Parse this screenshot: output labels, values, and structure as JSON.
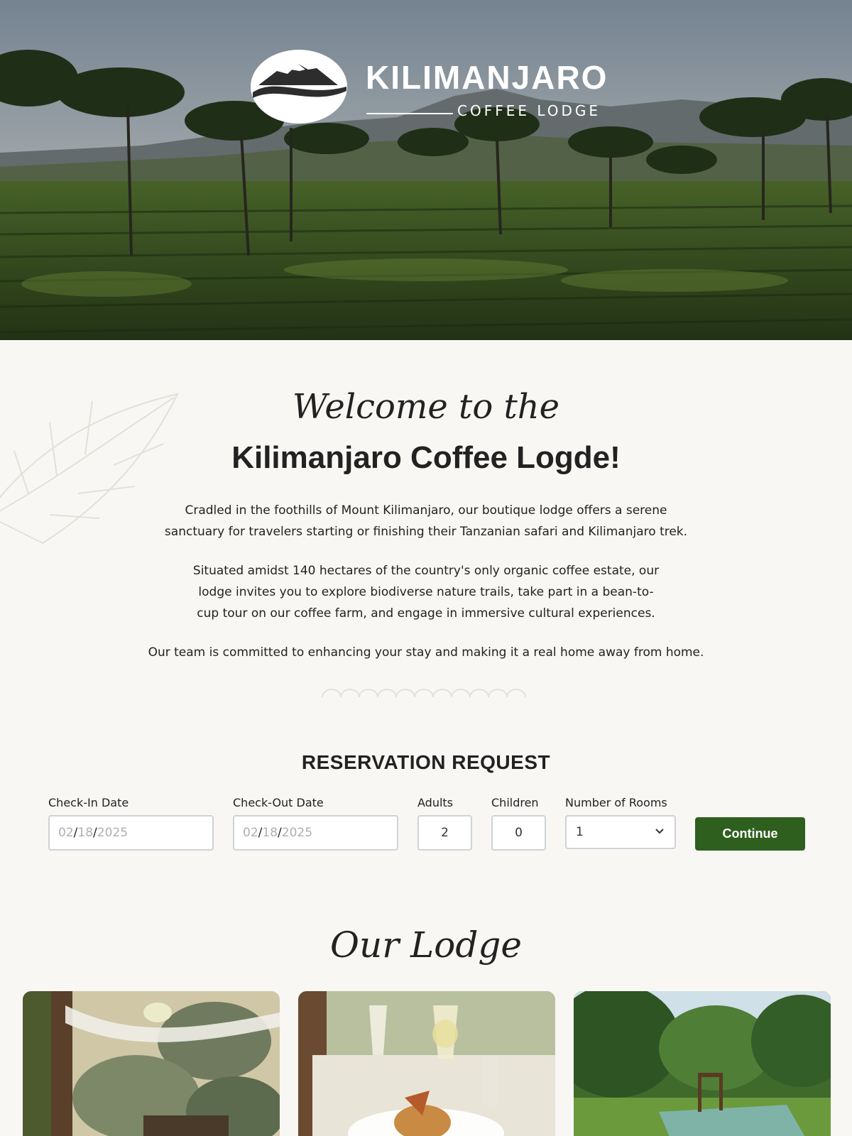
{
  "brand": {
    "name": "KILIMANJARO",
    "tagline": "COFFEE LODGE"
  },
  "welcome": {
    "script_heading": "Welcome to the",
    "title": "Kilimanjaro Coffee Logde!",
    "paragraphs": [
      "Cradled in the foothills of Mount Kilimanjaro, our boutique lodge offers a serene sanctuary for travelers starting or finishing their Tanzanian safari and Kilimanjaro trek.",
      "Situated amidst 140 hectares of the country's only organic coffee estate, our lodge invites you to explore biodiverse nature trails, take part in a bean-to-cup tour on our coffee farm, and engage in immersive cultural experiences.",
      "Our team is committed to enhancing your stay and making it a real home away from home."
    ]
  },
  "reservation": {
    "title": "RESERVATION REQUEST",
    "check_in": {
      "label": "Check-In Date",
      "month": "02",
      "day": "18",
      "year": "2025",
      "sep": "/"
    },
    "check_out": {
      "label": "Check-Out Date",
      "month": "02",
      "day": "18",
      "year": "2025",
      "sep": "/"
    },
    "adults": {
      "label": "Adults",
      "value": "2"
    },
    "children": {
      "label": "Children",
      "value": "0"
    },
    "rooms": {
      "label": "Number of Rooms",
      "value": "1"
    },
    "continue_label": "Continue"
  },
  "lodge": {
    "script_heading": "Our Lodge"
  },
  "colors": {
    "accent_green": "#2f5f1f",
    "page_bg": "#f8f7f4",
    "field_border": "#cfd2d6",
    "placeholder_gray": "#aab0b6"
  }
}
